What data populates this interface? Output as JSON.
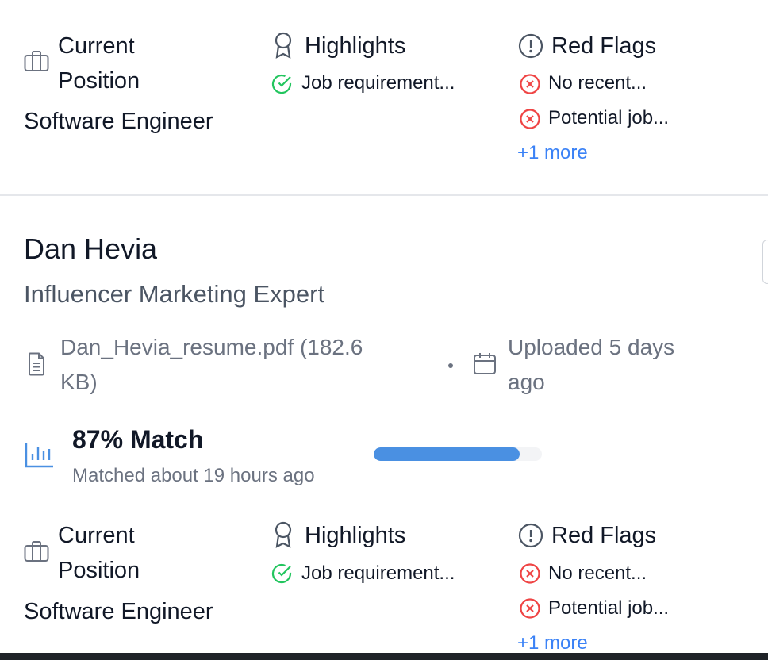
{
  "sections": {
    "current_position_title": [
      "Current",
      "Position"
    ],
    "highlights_title": "Highlights",
    "red_flags_title": "Red Flags"
  },
  "candidates": [
    {
      "current_position": "Software Engineer",
      "highlights": [
        "Job requirement..."
      ],
      "red_flags": [
        "No recent...",
        "Potential job..."
      ],
      "more_label": "+1 more"
    },
    {
      "name": "Dan Hevia",
      "role": "Influencer Marketing Expert",
      "resume_line1": "Dan_Hevia_resume.pdf (182.6",
      "resume_line2": "KB)",
      "uploaded_line1": "Uploaded 5 days",
      "uploaded_line2": "ago",
      "match_label": "87% Match",
      "match_percent": 87,
      "matched_at": "Matched about 19 hours ago",
      "current_position": "Software Engineer",
      "highlights": [
        "Job requirement..."
      ],
      "red_flags": [
        "No recent...",
        "Potential job..."
      ],
      "more_label": "+1 more"
    }
  ],
  "colors": {
    "accent": "#3b82f6",
    "progress": "#4a90e2",
    "success": "#22c55e",
    "danger": "#ef4444",
    "muted": "#6b7280"
  },
  "icons": [
    "briefcase-icon",
    "award-icon",
    "alert-circle-icon",
    "check-circle-icon",
    "x-circle-icon",
    "document-icon",
    "calendar-icon",
    "bar-chart-icon"
  ]
}
